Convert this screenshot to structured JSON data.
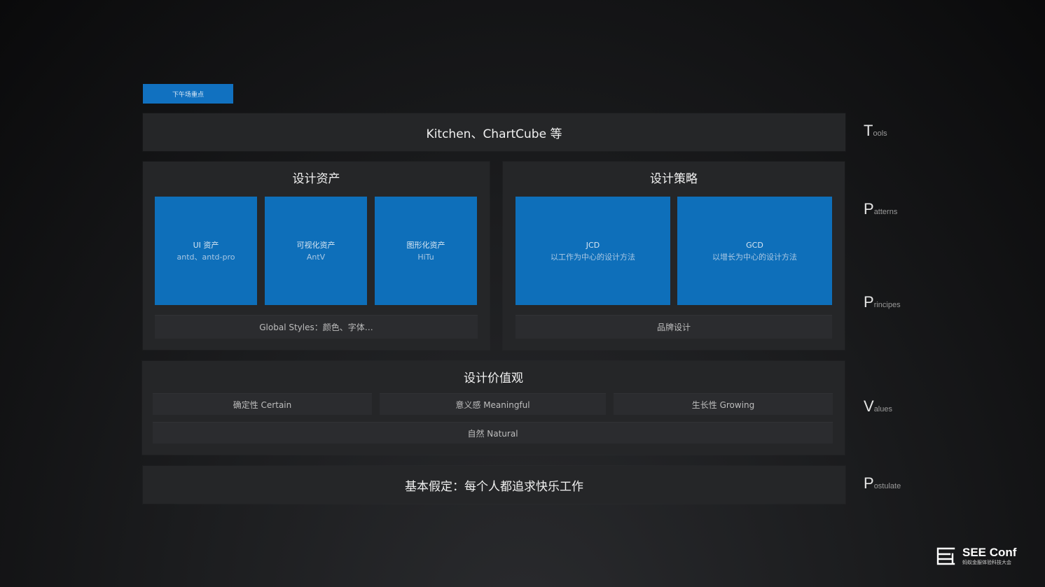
{
  "tag": "下午场重点",
  "tools_bar": "Kitchen、ChartCube 等",
  "assets": {
    "title": "设计资产",
    "cards": [
      {
        "title": "UI 资产",
        "sub": "antd、antd-pro"
      },
      {
        "title": "可视化资产",
        "sub": "AntV"
      },
      {
        "title": "图形化资产",
        "sub": "HiTu"
      }
    ],
    "footer": "Global Styles：颜色、字体…"
  },
  "strategy": {
    "title": "设计策略",
    "cards": [
      {
        "title": "JCD",
        "sub": "以工作为中心的设计方法"
      },
      {
        "title": "GCD",
        "sub": "以增长为中心的设计方法"
      }
    ],
    "footer": "品牌设计"
  },
  "values": {
    "title": "设计价值观",
    "items": [
      "确定性 Certain",
      "意义感 Meaningful",
      "生长性 Growing"
    ],
    "natural": "自然 Natural"
  },
  "postulate_text": "基本假定：每个人都追求快乐工作",
  "side_labels": [
    {
      "cap": "T",
      "rest": "ools"
    },
    {
      "cap": "P",
      "rest": "atterns"
    },
    {
      "cap": "P",
      "rest": "rincipes"
    },
    {
      "cap": "V",
      "rest": "alues"
    },
    {
      "cap": "P",
      "rest": "ostulate"
    }
  ],
  "logo": {
    "title": "SEE Conf",
    "subtitle": "蚂蚁金服体验科技大会"
  },
  "colors": {
    "accent_blue": "#0e6fba",
    "panel": "#252628",
    "background": "#121314"
  }
}
